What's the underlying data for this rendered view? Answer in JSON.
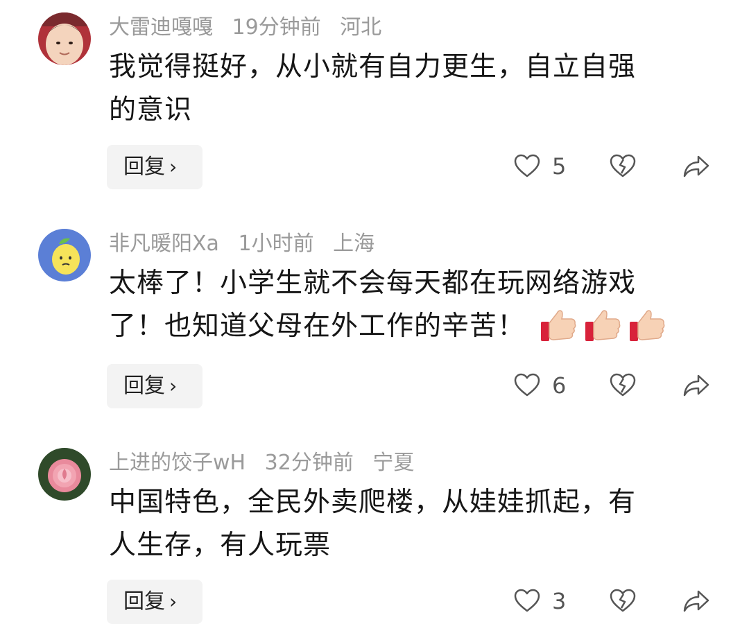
{
  "comments": [
    {
      "username": "大雷迪嘎嘎",
      "time": "19分钟前",
      "location": "河北",
      "text_lines": [
        "我觉得挺好，从小就有自力更生，自立自强",
        "的意识"
      ],
      "reply_label": "回复",
      "likes": "5",
      "avatar_icon": "baby-face-icon"
    },
    {
      "username": "非凡暖阳Xa",
      "time": "1小时前",
      "location": "上海",
      "text_lines": [
        "太棒了！小学生就不会每天都在玩网络游戏",
        "了！也知道父母在外工作的辛苦！"
      ],
      "emoji": [
        "thumbs-up-icon",
        "thumbs-up-icon",
        "thumbs-up-icon"
      ],
      "reply_label": "回复",
      "likes": "6",
      "avatar_icon": "lemon-icon"
    },
    {
      "username": "上进的饺子wH",
      "time": "32分钟前",
      "location": "宁夏",
      "text_lines": [
        "中国特色，全民外卖爬楼，从娃娃抓起，有",
        "人生存，有人玩票"
      ],
      "reply_label": "回复",
      "likes": "3",
      "avatar_icon": "rose-icon"
    }
  ],
  "colors": {
    "meta_text": "#9a9a9a",
    "body_text": "#161616",
    "reply_bg": "#f3f3f3",
    "icon_stroke": "#555555"
  }
}
